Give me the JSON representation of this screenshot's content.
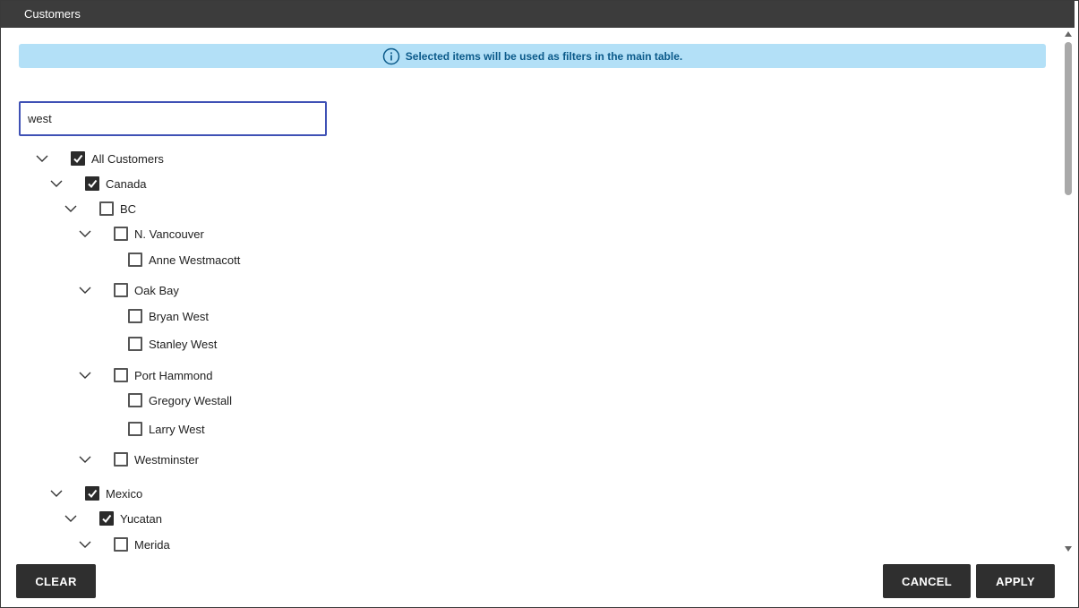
{
  "dialog": {
    "title": "Customers",
    "info_message": "Selected items will be used as filters in the main table."
  },
  "search": {
    "value": "west",
    "placeholder": ""
  },
  "tree": [
    {
      "label": "All Customers",
      "depth": 0,
      "checked": true,
      "expandable": true
    },
    {
      "label": "Canada",
      "depth": 1,
      "checked": true,
      "expandable": true
    },
    {
      "label": "BC",
      "depth": 2,
      "checked": false,
      "expandable": true
    },
    {
      "label": "N. Vancouver",
      "depth": 3,
      "checked": false,
      "expandable": true
    },
    {
      "label": "Anne Westmacott",
      "depth": 4,
      "checked": false,
      "expandable": false
    },
    {
      "label": "Oak Bay",
      "depth": 3,
      "checked": false,
      "expandable": true
    },
    {
      "label": "Bryan West",
      "depth": 4,
      "checked": false,
      "expandable": false
    },
    {
      "label": "Stanley West",
      "depth": 4,
      "checked": false,
      "expandable": false
    },
    {
      "label": "Port Hammond",
      "depth": 3,
      "checked": false,
      "expandable": true
    },
    {
      "label": "Gregory Westall",
      "depth": 4,
      "checked": false,
      "expandable": false
    },
    {
      "label": "Larry West",
      "depth": 4,
      "checked": false,
      "expandable": false
    },
    {
      "label": "Westminster",
      "depth": 3,
      "checked": false,
      "expandable": true
    },
    {
      "label": "Mexico",
      "depth": 1,
      "checked": true,
      "expandable": true
    },
    {
      "label": "Yucatan",
      "depth": 2,
      "checked": true,
      "expandable": true
    },
    {
      "label": "Merida",
      "depth": 3,
      "checked": false,
      "expandable": true
    }
  ],
  "buttons": {
    "clear": "CLEAR",
    "cancel": "CANCEL",
    "apply": "APPLY"
  },
  "icons": {
    "info": "info-circle-icon",
    "expand": "chevron-down-icon",
    "check": "checkmark-icon"
  },
  "colors": {
    "titlebar": "#3c3c3c",
    "banner_bg": "#b3e0f7",
    "banner_text": "#0b5a8a",
    "input_border": "#3f51b5",
    "button_bg": "#2f2f2f"
  }
}
